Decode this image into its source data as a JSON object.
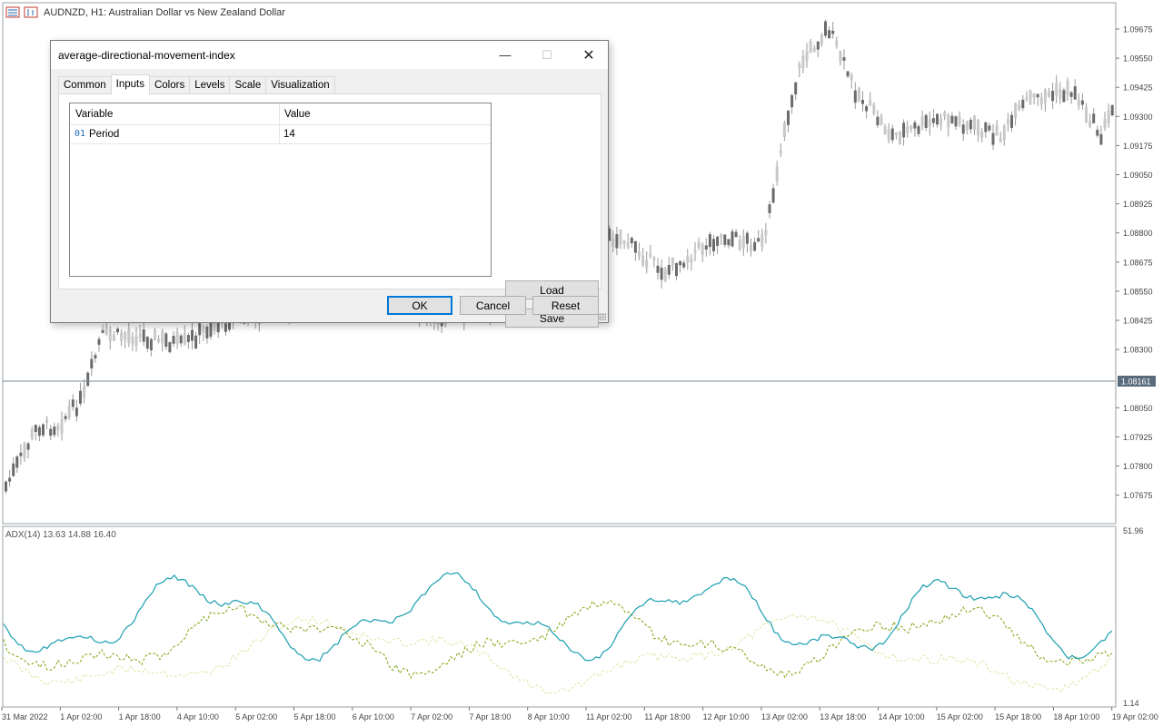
{
  "window": {
    "symbol_title": "AUDNZD, H1:  Australian Dollar vs New Zealand Dollar",
    "icons": [
      "chart-window-icon",
      "chart-type-icon"
    ]
  },
  "price_axis": {
    "labels": [
      "1.09675",
      "1.09550",
      "1.09425",
      "1.09300",
      "1.09175",
      "1.09050",
      "1.08925",
      "1.08800",
      "1.08675",
      "1.08550",
      "1.08425",
      "1.08300",
      "1.08050",
      "1.07925",
      "1.07800",
      "1.07675"
    ],
    "current_price": "1.08161",
    "current_price_color": "#5a6b7b"
  },
  "time_axis": {
    "labels": [
      "31 Mar 2022",
      "1 Apr 02:00",
      "1 Apr 18:00",
      "4 Apr 10:00",
      "5 Apr 02:00",
      "5 Apr 18:00",
      "6 Apr 10:00",
      "7 Apr 02:00",
      "7 Apr 18:00",
      "8 Apr 10:00",
      "11 Apr 02:00",
      "11 Apr 18:00",
      "12 Apr 10:00",
      "13 Apr 02:00",
      "13 Apr 18:00",
      "14 Apr 10:00",
      "15 Apr 02:00",
      "15 Apr 18:00",
      "18 Apr 10:00",
      "19 Apr 02:00"
    ]
  },
  "indicator": {
    "label": "ADX(14) 13.63 14.88 16.40",
    "axis_max": "51.96",
    "axis_min": "1.14",
    "colors": {
      "adx": "#1a9fb0",
      "plus_di": "#7fa512",
      "minus_di": "#e3e3a3"
    }
  },
  "dialog": {
    "title": "average-directional-movement-index",
    "tabs": [
      {
        "label": "Common",
        "active": false
      },
      {
        "label": "Inputs",
        "active": true
      },
      {
        "label": "Colors",
        "active": false
      },
      {
        "label": "Levels",
        "active": false
      },
      {
        "label": "Scale",
        "active": false
      },
      {
        "label": "Visualization",
        "active": false
      }
    ],
    "table": {
      "col_variable": "Variable",
      "col_value": "Value",
      "rows": [
        {
          "icon": "01",
          "name": "Period",
          "value": "14"
        }
      ]
    },
    "buttons": {
      "load": "Load",
      "save": "Save",
      "ok": "OK",
      "cancel": "Cancel",
      "reset": "Reset"
    }
  }
}
